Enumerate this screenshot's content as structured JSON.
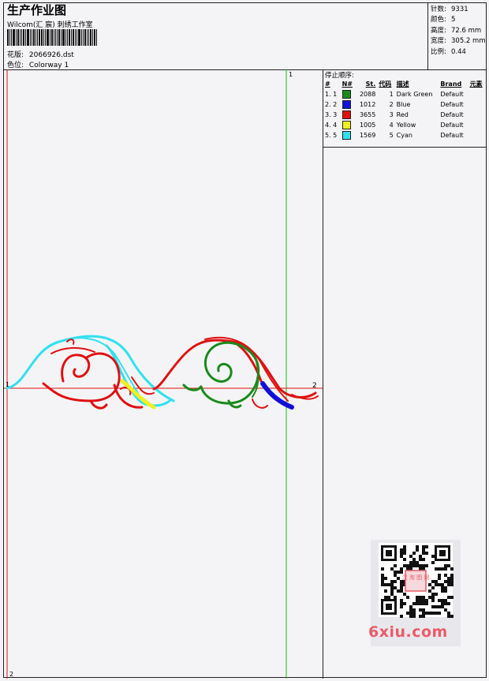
{
  "header": {
    "title": "生产作业图",
    "software": "Wilcom(汇 宸) 刺绣工作室",
    "design_label": "花版:",
    "design_file": "2066926.dst",
    "colorway_label": "色位:",
    "colorway": "Colorway 1"
  },
  "stats": [
    {
      "label": "针数:",
      "value": "9331"
    },
    {
      "label": "颜色:",
      "value": "5"
    },
    {
      "label": "高度:",
      "value": "72.6 mm"
    },
    {
      "label": "宽度:",
      "value": "305.2 mm"
    },
    {
      "label": "比例:",
      "value": "0.44"
    }
  ],
  "guides": {
    "top_marker": "1",
    "left_marker": "1",
    "right_marker": "2",
    "bottom_marker": "2"
  },
  "colors_panel": {
    "title": "停止顺序:",
    "columns": [
      "#",
      "N#",
      "St.",
      "代码",
      "描述",
      "Brand",
      "元素"
    ],
    "rows": [
      {
        "index": "1. 1",
        "stitches": "2088",
        "code": "1",
        "description": "Dark Green",
        "brand": "Default",
        "color": "#1a8a1a"
      },
      {
        "index": "2. 2",
        "stitches": "1012",
        "code": "2",
        "description": "Blue",
        "brand": "Default",
        "color": "#1010d8"
      },
      {
        "index": "3. 3",
        "stitches": "3655",
        "code": "3",
        "description": "Red",
        "brand": "Default",
        "color": "#e01010"
      },
      {
        "index": "4. 4",
        "stitches": "1005",
        "code": "4",
        "description": "Yellow",
        "brand": "Default",
        "color": "#f0f020"
      },
      {
        "index": "5. 5",
        "stitches": "1569",
        "code": "5",
        "description": "Cyan",
        "brand": "Default",
        "color": "#30e0f0"
      }
    ]
  },
  "watermark": {
    "site": "6xiu.com",
    "seal_text": "汉 淘 图 网"
  }
}
